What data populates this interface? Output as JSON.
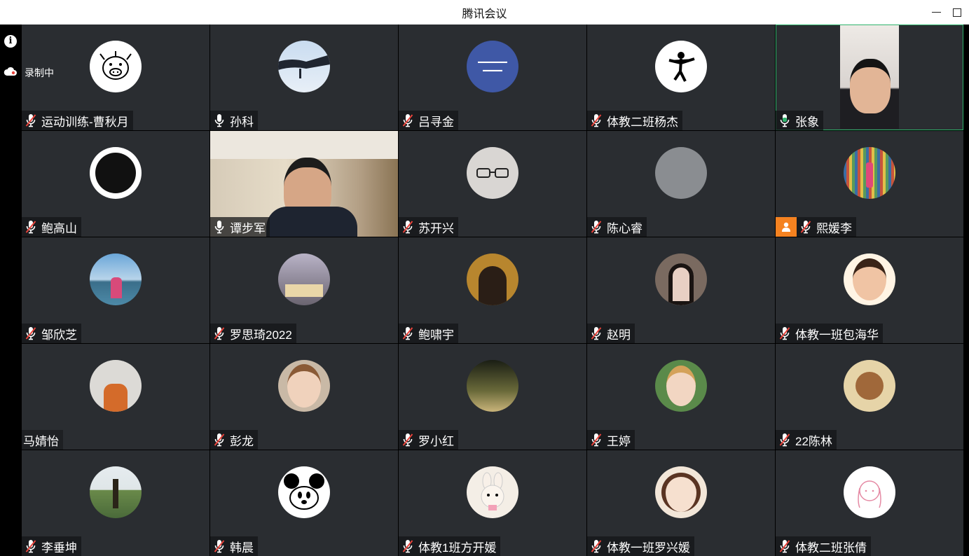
{
  "window": {
    "title": "腾讯会议"
  },
  "status": {
    "recording_label": "录制中"
  },
  "colors": {
    "tile_bg": "#2a2d31",
    "active_border": "#2fb36c",
    "mic_on": "#ffffff",
    "mic_speaking": "#2fb36c",
    "mic_muted": "#e9433b",
    "badge_orange": "#f58220"
  },
  "participants": [
    {
      "name": "运动训练-曹秋月",
      "mic": "muted",
      "avatar": "pig-doodle-icon"
    },
    {
      "name": "孙科",
      "mic": "on",
      "avatar": "pagoda-roof-photo"
    },
    {
      "name": "吕寻金",
      "mic": "muted",
      "avatar": "blue-lecture-poster"
    },
    {
      "name": "体教二班杨杰",
      "mic": "muted",
      "avatar": "jumping-silhouette-icon"
    },
    {
      "name": "张象",
      "mic": "speaking",
      "avatar": "live-video",
      "active": true
    },
    {
      "name": "鲍高山",
      "mic": "muted",
      "avatar": "tiger-logo"
    },
    {
      "name": "谭步军",
      "mic": "on",
      "avatar": "live-video"
    },
    {
      "name": "苏开兴",
      "mic": "muted",
      "avatar": "glasses-drawing"
    },
    {
      "name": "陈心睿",
      "mic": "muted",
      "avatar": "gray-blank"
    },
    {
      "name": "熙媛李",
      "mic": "muted",
      "avatar": "bookshelf-photo",
      "badge": "person-icon"
    },
    {
      "name": "邹欣芝",
      "mic": "muted",
      "avatar": "lake-photo"
    },
    {
      "name": "罗思琦2022",
      "mic": "muted",
      "avatar": "building-photo"
    },
    {
      "name": "鲍啸宇",
      "mic": "muted",
      "avatar": "portrait-photo"
    },
    {
      "name": "赵明",
      "mic": "muted",
      "avatar": "girl-portrait"
    },
    {
      "name": "体教一班包海华",
      "mic": "muted",
      "avatar": "cartoon-girl"
    },
    {
      "name": "马婧怡",
      "mic": "none",
      "avatar": "girl-photo"
    },
    {
      "name": "彭龙",
      "mic": "muted",
      "avatar": "child-photo"
    },
    {
      "name": "罗小红",
      "mic": "muted",
      "avatar": "trees-sunset"
    },
    {
      "name": "王婷",
      "mic": "muted",
      "avatar": "woman-drink"
    },
    {
      "name": "22陈林",
      "mic": "muted",
      "avatar": "cartoon-mouse"
    },
    {
      "name": "李垂坤",
      "mic": "muted",
      "avatar": "man-field"
    },
    {
      "name": "韩晨",
      "mic": "muted",
      "avatar": "minnie-mouse"
    },
    {
      "name": "体教1班方开媛",
      "mic": "muted",
      "avatar": "bunny-plush"
    },
    {
      "name": "体教一班罗兴媛",
      "mic": "muted",
      "avatar": "anime-girl"
    },
    {
      "name": "体教二班张倩",
      "mic": "muted",
      "avatar": "line-drawing-girl"
    }
  ]
}
